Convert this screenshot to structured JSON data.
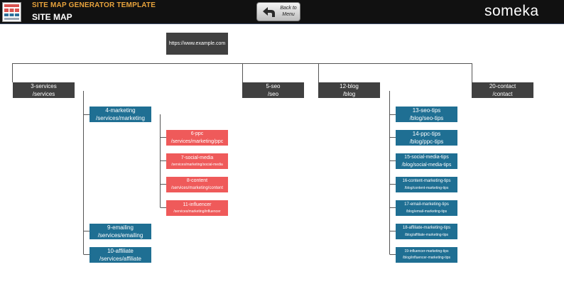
{
  "header": {
    "app_title": "SITE MAP GENERATOR TEMPLATE",
    "page_title": "SITE MAP",
    "back_button_label": "Back to Menu",
    "brand": "someka",
    "logo_icon": "sitemap-logo-icon",
    "back_icon": "back-arrow-icon"
  },
  "colors": {
    "header_bg": "#111111",
    "app_title": "#e8a33c",
    "level1_node": "#404040",
    "level2_node": "#1f6f93",
    "level3_node": "#ef5a5a",
    "connector": "#555555"
  },
  "sitemap": {
    "root": "https://www.example.com",
    "nodes": {
      "services": {
        "name": "3-services",
        "path": "/services"
      },
      "seo": {
        "name": "5-seo",
        "path": "/seo"
      },
      "blog": {
        "name": "12-blog",
        "path": "/blog"
      },
      "contact": {
        "name": "20-contact",
        "path": "/contact"
      },
      "marketing": {
        "name": "4-marketing",
        "path": "/services/marketing"
      },
      "emailing": {
        "name": "9-emailing",
        "path": "/services/emailing"
      },
      "affiliate": {
        "name": "10-affiliate",
        "path": "/services/affiliate"
      },
      "ppc": {
        "name": "6-ppc",
        "path": "/services/marketing/ppc"
      },
      "social_media": {
        "name": "7-social-media",
        "path": "/services/marketing/social-media"
      },
      "content": {
        "name": "8-content",
        "path": "/services/marketing/content"
      },
      "influencer": {
        "name": "11-influencer",
        "path": "/services/marketing/influencer"
      },
      "seo_tips": {
        "name": "13-seo-tips",
        "path": "/blog/seo-tips"
      },
      "ppc_tips": {
        "name": "14-ppc-tips",
        "path": "/blog/ppc-tips"
      },
      "social_tips": {
        "name": "15-social-media-tips",
        "path": "/blog/social-media-tips"
      },
      "content_tips": {
        "name": "16-content-marketing-tips",
        "path": "/blog/content-marketing-tips"
      },
      "email_tips": {
        "name": "17-email-marketing-tips",
        "path": "/blog/email-marketing-tips"
      },
      "affiliate_tips": {
        "name": "18-affiliate-marketing-tips",
        "path": "/blog/affiliate-marketing-tips"
      },
      "influencer_tips": {
        "name": "19-influencer-marketing-tips",
        "path": "/blog/influencer-marketing-tips"
      }
    }
  }
}
